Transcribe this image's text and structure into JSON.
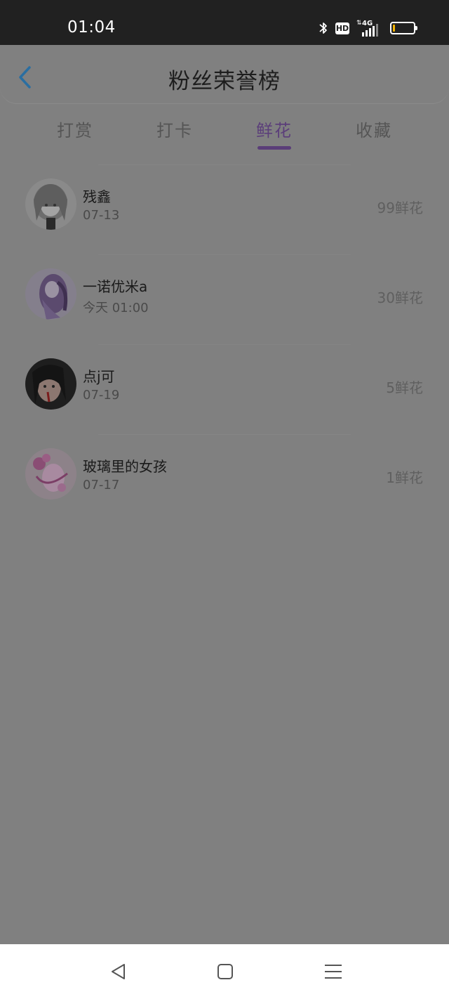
{
  "status_bar": {
    "time": "01:04",
    "icons": [
      "bluetooth-icon",
      "hd-icon",
      "signal-4g-icon",
      "battery-icon"
    ],
    "hd_label": "HD",
    "network_label": "4G",
    "battery_level": 0.08,
    "battery_color": "#f5b400"
  },
  "header": {
    "title": "粉丝荣誉榜",
    "back_icon": "chevron-left-icon",
    "back_icon_color": "#2a6ea1"
  },
  "tabs": [
    {
      "label": "打赏",
      "active": false
    },
    {
      "label": "打卡",
      "active": false
    },
    {
      "label": "鲜花",
      "active": true
    },
    {
      "label": "收藏",
      "active": false
    }
  ],
  "accent_color": "#5a3d78",
  "fans": [
    {
      "name": "残鑫",
      "date": "07-13",
      "count": "99鲜花"
    },
    {
      "name": "一诺优米a",
      "date": "今天 01:00",
      "count": "30鲜花"
    },
    {
      "name": "点j可",
      "date": "07-19",
      "count": "5鲜花"
    },
    {
      "name": "玻璃里的女孩",
      "date": "07-17",
      "count": "1鲜花"
    }
  ],
  "nav_bar": {
    "icons": [
      "back-triangle-icon",
      "home-square-icon",
      "menu-lines-icon"
    ]
  }
}
